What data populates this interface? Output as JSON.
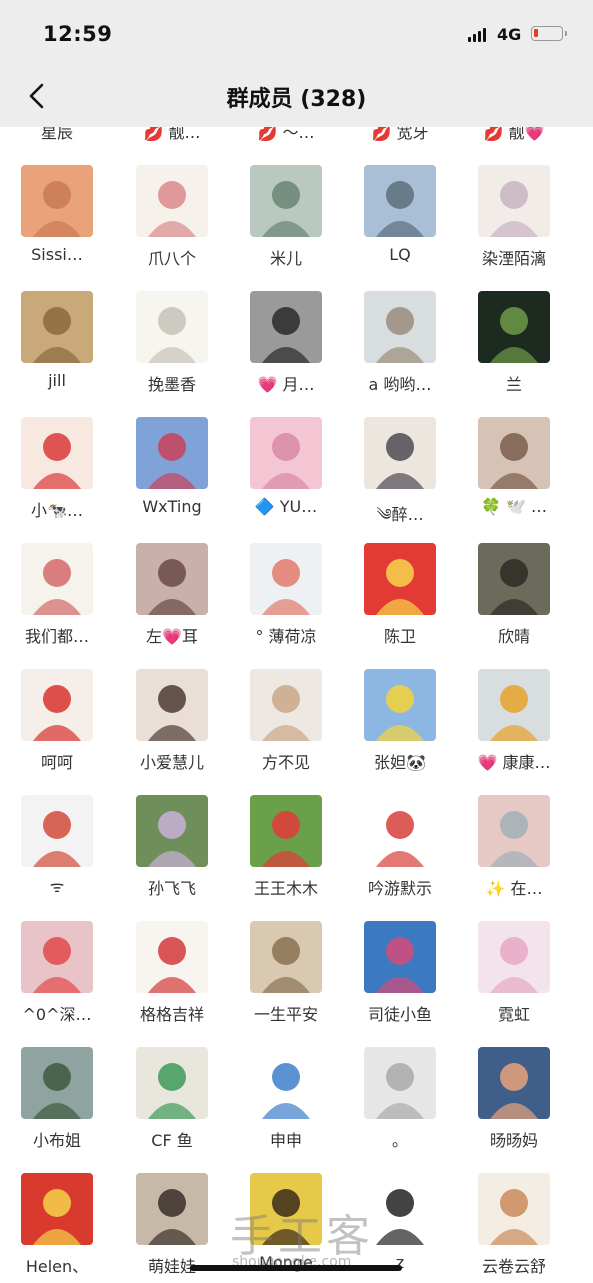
{
  "status_bar": {
    "time": "12:59",
    "network": "4G",
    "battery_level": 0.15,
    "battery_color": "#e8392e"
  },
  "header": {
    "title": "群成员 (328)",
    "back_icon": "chevron-left-icon"
  },
  "partial_row_names": [
    "星辰",
    "💋 靓…",
    "💋 ～…",
    "💋 宽牙",
    "💋 靓💗"
  ],
  "members": [
    {
      "name": "Sissi…",
      "colors": [
        "#e9a27a",
        "#c97a55"
      ]
    },
    {
      "name": "爪八个",
      "colors": [
        "#f6f1ea",
        "#d98a8a"
      ]
    },
    {
      "name": "米儿",
      "colors": [
        "#b9c9bf",
        "#6a8574"
      ]
    },
    {
      "name": "LQ",
      "colors": [
        "#a9bfd6",
        "#5d6f7e"
      ]
    },
    {
      "name": "染湮陌漓",
      "colors": [
        "#f2ece8",
        "#c9b4c3"
      ]
    },
    {
      "name": "jill",
      "colors": [
        "#c9a97a",
        "#8a6a3e"
      ]
    },
    {
      "name": "挽墨香",
      "colors": [
        "#f7f5f0",
        "#c7c2b8"
      ]
    },
    {
      "name": "💗 月…",
      "colors": [
        "#9a9a9a",
        "#2a2a2a"
      ]
    },
    {
      "name": "a 哟哟…",
      "colors": [
        "#d8dde0",
        "#9b8c7c"
      ]
    },
    {
      "name": "兰",
      "colors": [
        "#1c2a20",
        "#6e9a4a"
      ]
    },
    {
      "name": "小🐄…",
      "colors": [
        "#f7e9e0",
        "#d93a3a"
      ]
    },
    {
      "name": "WxTing",
      "colors": [
        "#7fa3d9",
        "#c9425a"
      ]
    },
    {
      "name": "🔷 YU…",
      "colors": [
        "#f4c6d4",
        "#d98aa6"
      ]
    },
    {
      "name": "༄醉…",
      "colors": [
        "#ece6df",
        "#4e4a54"
      ]
    },
    {
      "name": "🍀 🕊️ …",
      "colors": [
        "#d7c3b6",
        "#7a5d4c"
      ]
    },
    {
      "name": "我们都…",
      "colors": [
        "#f6f2ec",
        "#d46a6a"
      ]
    },
    {
      "name": "左💗耳",
      "colors": [
        "#c9b0a8",
        "#6a4a48"
      ]
    },
    {
      "name": "° 薄荷凉",
      "colors": [
        "#eef1f4",
        "#e07a6a"
      ]
    },
    {
      "name": "陈卫",
      "colors": [
        "#e43a36",
        "#f6d54a"
      ]
    },
    {
      "name": "欣晴",
      "colors": [
        "#6c6a5a",
        "#2c2b24"
      ]
    },
    {
      "name": "呵呵",
      "colors": [
        "#f5eee9",
        "#d9322e"
      ]
    },
    {
      "name": "小爱慧儿",
      "colors": [
        "#e9dfd7",
        "#4d3c34"
      ]
    },
    {
      "name": "方不见",
      "colors": [
        "#eee8e2",
        "#c9a888"
      ]
    },
    {
      "name": "张妲🐼",
      "colors": [
        "#8cb7e3",
        "#f5d33a"
      ]
    },
    {
      "name": "💗 康康…",
      "colors": [
        "#d8dde0",
        "#e7a32a"
      ]
    },
    {
      "name": "ᯤ",
      "colors": [
        "#f3f3f3",
        "#d24a3a"
      ]
    },
    {
      "name": "孙飞飞",
      "colors": [
        "#6f8f5a",
        "#c9b0d8"
      ]
    },
    {
      "name": "王王木木",
      "colors": [
        "#6aa04a",
        "#e23a3a"
      ]
    },
    {
      "name": "吟游默示",
      "colors": [
        "#ffffff",
        "#d7403a"
      ]
    },
    {
      "name": "✨ 在…",
      "colors": [
        "#e6c9c4",
        "#9fb0b8"
      ]
    },
    {
      "name": "^0^深…",
      "colors": [
        "#e8c3c8",
        "#e24a4a"
      ]
    },
    {
      "name": "格格吉祥",
      "colors": [
        "#f8f5f0",
        "#d23a3a"
      ]
    },
    {
      "name": "一生平安",
      "colors": [
        "#d9c9b0",
        "#8a7254"
      ]
    },
    {
      "name": "司徒小鱼",
      "colors": [
        "#3b7ac0",
        "#d64a7a"
      ]
    },
    {
      "name": "霓虹",
      "colors": [
        "#f3e4ec",
        "#e6a8c4"
      ]
    },
    {
      "name": "小布姐",
      "colors": [
        "#8fa4a0",
        "#3e5a40"
      ]
    },
    {
      "name": "CF 鱼",
      "colors": [
        "#e9e6de",
        "#3e9a5a"
      ]
    },
    {
      "name": "申申",
      "colors": [
        "#ffffff",
        "#3e7fc9"
      ]
    },
    {
      "name": "。",
      "colors": [
        "#e6e6e6",
        "#a9a9a9"
      ]
    },
    {
      "name": "旸旸妈",
      "colors": [
        "#3f5f8a",
        "#e7a27a"
      ]
    },
    {
      "name": "Helen、",
      "colors": [
        "#d93a2e",
        "#f4d24a"
      ]
    },
    {
      "name": "萌娃娃",
      "colors": [
        "#c7b9a8",
        "#3a2f2a"
      ]
    },
    {
      "name": "Monge",
      "colors": [
        "#e7c94a",
        "#3a2a1a"
      ]
    },
    {
      "name": "z",
      "colors": [
        "#ffffff",
        "#222222"
      ]
    },
    {
      "name": "云卷云舒",
      "colors": [
        "#f4ede4",
        "#c98a5a"
      ]
    }
  ],
  "watermark": {
    "text": "手工客",
    "url": "shougongke.com"
  }
}
